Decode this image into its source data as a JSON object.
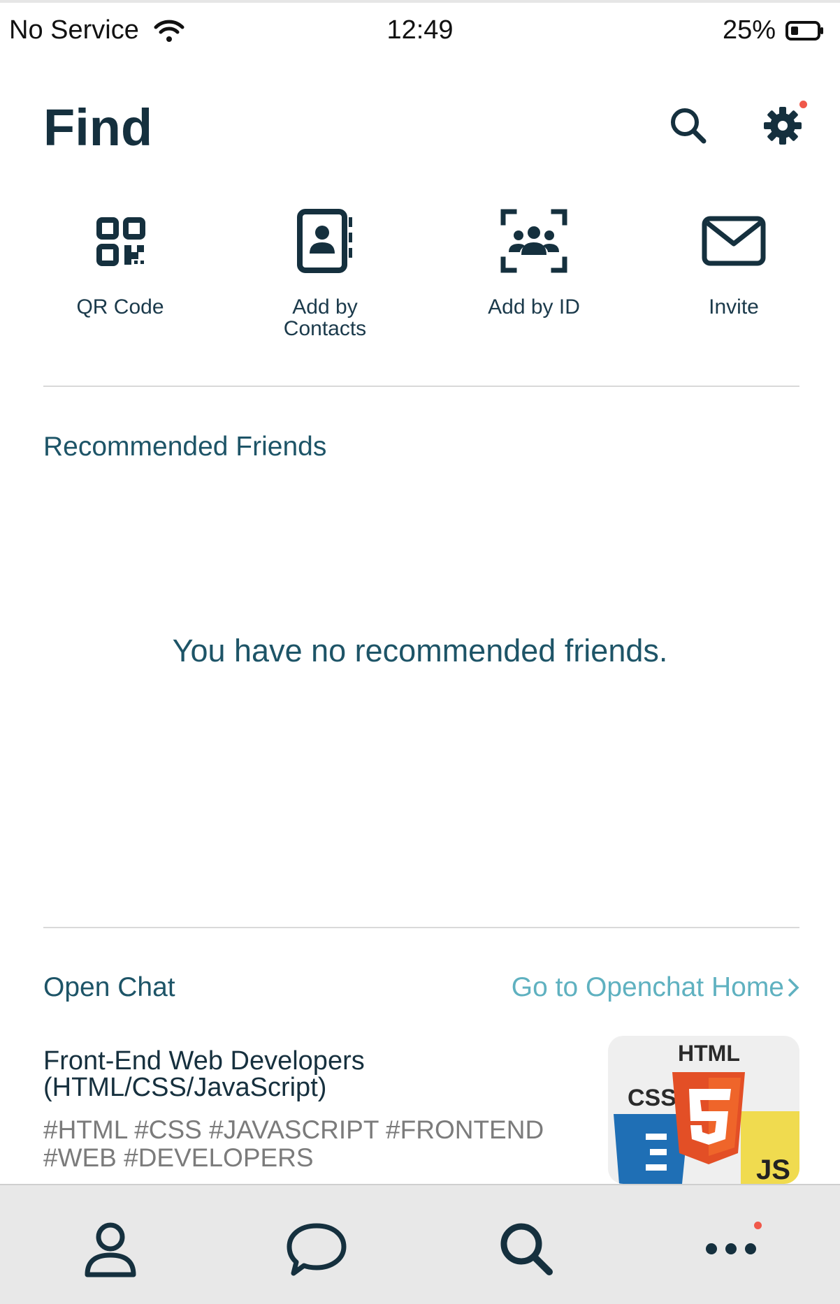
{
  "status_bar": {
    "carrier": "No Service",
    "time": "12:49",
    "battery": "25%"
  },
  "header": {
    "title": "Find"
  },
  "quick_actions": [
    {
      "label": "QR Code",
      "icon": "qr-code-icon"
    },
    {
      "label": "Add by Contacts",
      "icon": "contacts-book-icon"
    },
    {
      "label": "Add by ID",
      "icon": "group-scan-icon"
    },
    {
      "label": "Invite",
      "icon": "envelope-icon"
    }
  ],
  "recommended": {
    "title": "Recommended Friends",
    "empty_message": "You have no recommended friends."
  },
  "open_chat": {
    "title": "Open Chat",
    "home_link": "Go to Openchat Home",
    "item": {
      "title": "Front-End Web Developers (HTML/CSS/JavaScript)",
      "tags": "#HTML #CSS #JAVASCRIPT #FRONTEND #WEB #DEVELOPERS",
      "thumb_labels": {
        "html": "HTML",
        "css": "CSS",
        "js": "JS"
      }
    }
  },
  "bottom_nav": [
    {
      "name": "friends",
      "icon": "person-icon"
    },
    {
      "name": "chats",
      "icon": "chat-bubble-icon"
    },
    {
      "name": "find",
      "icon": "search-icon"
    },
    {
      "name": "more",
      "icon": "more-dots-icon"
    }
  ],
  "colors": {
    "primary_dark": "#15303e",
    "section_text": "#1d5467",
    "link": "#5fb1c0",
    "badge": "#f0584a",
    "nav_bg": "#e8e8e8"
  }
}
